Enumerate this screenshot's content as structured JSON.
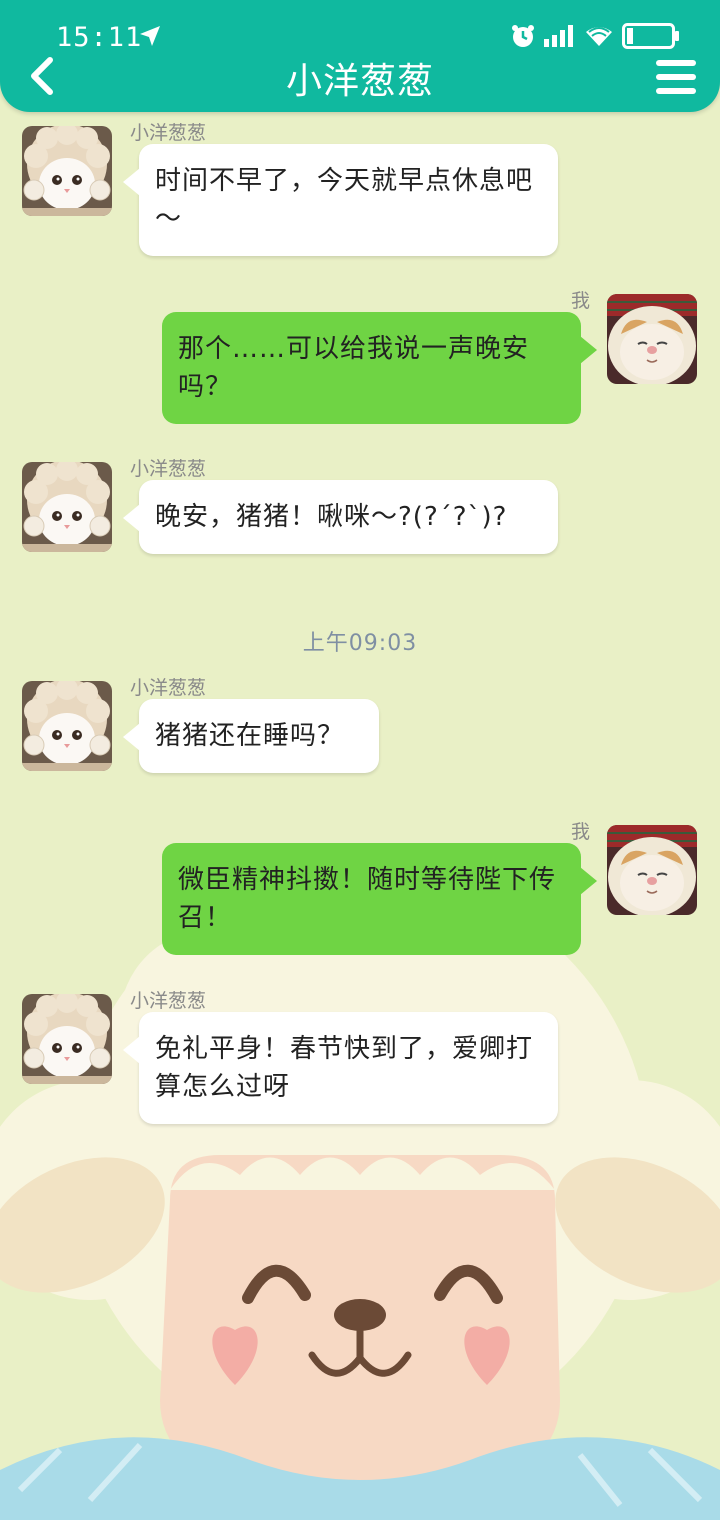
{
  "status_bar": {
    "time": "15:11"
  },
  "header": {
    "title": "小洋葱葱"
  },
  "colors": {
    "header": "#10b99f",
    "bubble_out": "#6fd444",
    "bubble_in": "#ffffff",
    "background": "#e9f0c6"
  },
  "icons": [
    "location-arrow-icon",
    "alarm-icon",
    "signal-icon",
    "wifi-icon",
    "battery-icon",
    "back-icon",
    "menu-icon"
  ],
  "messages": [
    {
      "from": "小洋葱葱",
      "text": "时间不早了，今天就早点休息吧～"
    },
    {
      "from": "我",
      "text": "那个……可以给我说一声晚安吗？"
    },
    {
      "from": "小洋葱葱",
      "text": "晚安，猪猪！啾咪～?(?´?`)?"
    },
    {
      "from": "小洋葱葱",
      "text": "猪猪还在睡吗？"
    },
    {
      "from": "我",
      "text": "微臣精神抖擞！随时等待陛下传召！"
    },
    {
      "from": "小洋葱葱",
      "text": "免礼平身！春节快到了，爱卿打算怎么过呀"
    }
  ],
  "timestamp": "上午09:03"
}
